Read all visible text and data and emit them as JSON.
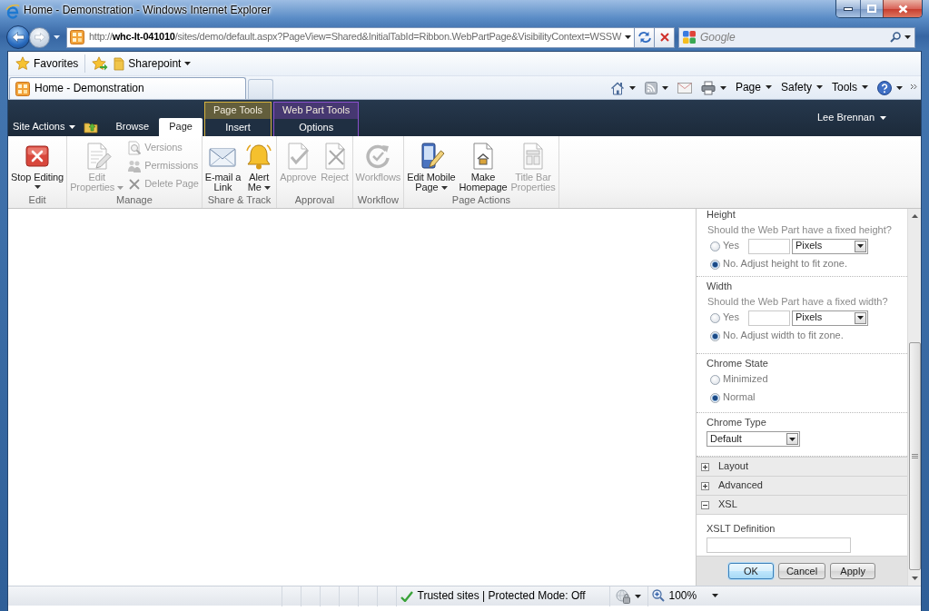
{
  "window": {
    "title": "Home - Demonstration - Windows Internet Explorer"
  },
  "address_bar": {
    "url": "http://**whc-lt-041010**/sites/demo/default.aspx?PageView=Shared&InitialTabId=Ribbon.WebPartPage&VisibilityContext=WSSW"
  },
  "search": {
    "placeholder": "Google"
  },
  "favorites_bar": {
    "favorites": "Favorites",
    "links": [
      {
        "label": "Sharepoint"
      }
    ]
  },
  "tabs": [
    {
      "label": "Home - Demonstration",
      "selected": true
    }
  ],
  "command_bar": {
    "menus": [
      {
        "label": "Page"
      },
      {
        "label": "Safety"
      },
      {
        "label": "Tools"
      }
    ]
  },
  "ribbon": {
    "site_actions": "Site Actions",
    "tabs": [
      {
        "label": "Browse",
        "selected": false
      },
      {
        "label": "Page",
        "selected": true
      }
    ],
    "contextual_groups": [
      {
        "title": "Page Tools",
        "color": "#d6b23e",
        "tabs": [
          {
            "label": "Insert",
            "selected": false
          }
        ]
      },
      {
        "title": "Web Part Tools",
        "color": "#8b4fcc",
        "tabs": [
          {
            "label": "Options",
            "selected": false
          }
        ]
      }
    ],
    "user": "Lee Brennan",
    "groups": [
      {
        "label": "Edit",
        "commands": [
          {
            "label": "Stop Editing",
            "kind": "large",
            "disabled": false,
            "dropdown": true
          }
        ]
      },
      {
        "label": "Manage",
        "commands": [
          {
            "label": "Edit\nProperties",
            "kind": "large",
            "disabled": true,
            "dropdown": true
          },
          {
            "label": "Versions",
            "kind": "small",
            "disabled": true
          },
          {
            "label": "Permissions",
            "kind": "small",
            "disabled": true
          },
          {
            "label": "Delete Page",
            "kind": "small",
            "disabled": true
          }
        ]
      },
      {
        "label": "Share & Track",
        "commands": [
          {
            "label": "E-mail a\nLink",
            "kind": "large",
            "disabled": false
          },
          {
            "label": "Alert\nMe",
            "kind": "large",
            "disabled": false,
            "dropdown": true
          }
        ]
      },
      {
        "label": "Approval",
        "commands": [
          {
            "label": "Approve",
            "kind": "large",
            "disabled": true
          },
          {
            "label": "Reject",
            "kind": "large",
            "disabled": true
          }
        ]
      },
      {
        "label": "Workflow",
        "commands": [
          {
            "label": "Workflows",
            "kind": "large",
            "disabled": true
          }
        ]
      },
      {
        "label": "Page Actions",
        "commands": [
          {
            "label": "Edit Mobile\nPage",
            "kind": "large",
            "disabled": false,
            "dropdown": true
          },
          {
            "label": "Make\nHomepage",
            "kind": "large",
            "disabled": false
          },
          {
            "label": "Title Bar\nProperties",
            "kind": "large",
            "disabled": true
          }
        ]
      }
    ]
  },
  "tool_pane": {
    "sections": [
      {
        "kind": "dimension",
        "title": "Height",
        "question": "Should the Web Part have a fixed height?",
        "fixed": {
          "label": "Yes",
          "selected": false,
          "unit": "Pixels"
        },
        "auto": {
          "label": "No. Adjust height to fit zone.",
          "selected": true
        }
      },
      {
        "kind": "dimension",
        "title": "Width",
        "question": "Should the Web Part have a fixed width?",
        "fixed": {
          "label": "Yes",
          "selected": false,
          "unit": "Pixels"
        },
        "auto": {
          "label": "No. Adjust width to fit zone.",
          "selected": true
        }
      },
      {
        "kind": "radios",
        "title": "Chrome State",
        "options": [
          {
            "label": "Minimized",
            "selected": false
          },
          {
            "label": "Normal",
            "selected": true
          }
        ]
      },
      {
        "kind": "select",
        "title": "Chrome Type",
        "value": "Default"
      }
    ],
    "categories": [
      {
        "label": "Layout",
        "expanded": false
      },
      {
        "label": "Advanced",
        "expanded": false
      },
      {
        "label": "XSL",
        "expanded": true,
        "fields": [
          {
            "label": "XSLT Definition"
          }
        ]
      }
    ],
    "buttons": [
      {
        "label": "OK",
        "focused": true
      },
      {
        "label": "Cancel",
        "focused": false
      },
      {
        "label": "Apply",
        "focused": false
      }
    ]
  },
  "status_bar": {
    "zone": "Trusted sites | Protected Mode: Off",
    "zoom": "100%"
  }
}
